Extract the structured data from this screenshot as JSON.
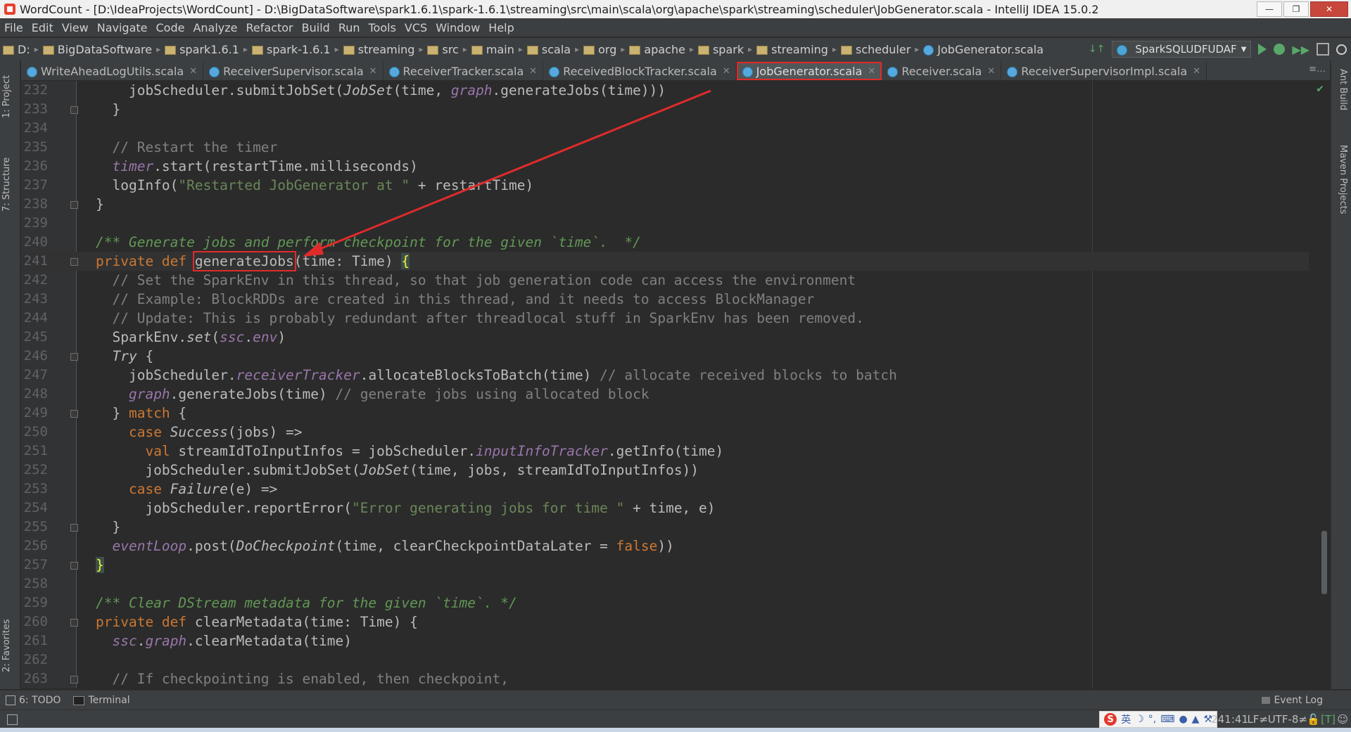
{
  "window": {
    "title": "WordCount - [D:\\IdeaProjects\\WordCount] - D:\\BigDataSoftware\\spark1.6.1\\spark-1.6.1\\streaming\\src\\main\\scala\\org\\apache\\spark\\streaming\\scheduler\\JobGenerator.scala - IntelliJ IDEA 15.0.2",
    "minimize": "—",
    "maximize": "❐",
    "close": "✕"
  },
  "menu": [
    "File",
    "Edit",
    "View",
    "Navigate",
    "Code",
    "Analyze",
    "Refactor",
    "Build",
    "Run",
    "Tools",
    "VCS",
    "Window",
    "Help"
  ],
  "breadcrumb": [
    "D:",
    "BigDataSoftware",
    "spark1.6.1",
    "spark-1.6.1",
    "streaming",
    "src",
    "main",
    "scala",
    "org",
    "apache",
    "spark",
    "streaming",
    "scheduler",
    "JobGenerator.scala"
  ],
  "run_config": "SparkSQLUDFUDAF",
  "tabs": [
    {
      "label": "WriteAheadLogUtils.scala",
      "active": false
    },
    {
      "label": "ReceiverSupervisor.scala",
      "active": false
    },
    {
      "label": "ReceiverTracker.scala",
      "active": false
    },
    {
      "label": "ReceivedBlockTracker.scala",
      "active": false
    },
    {
      "label": "JobGenerator.scala",
      "active": true
    },
    {
      "label": "Receiver.scala",
      "active": false
    },
    {
      "label": "ReceiverSupervisorImpl.scala",
      "active": false
    }
  ],
  "tab_menu": "≡…",
  "side_tools": {
    "left": [
      "1: Project",
      "7: Structure",
      "2: Favorites"
    ],
    "right": [
      "Ant Build",
      "Maven Projects"
    ]
  },
  "code_lines": [
    {
      "n": "232",
      "fold": false,
      "html": "    jobScheduler.submitJobSet(<span class=\"it\">JobSet</span>(time, <span class=\"f\">graph</span>.generateJobs(time)))"
    },
    {
      "n": "233",
      "fold": true,
      "html": "  }"
    },
    {
      "n": "234",
      "fold": false,
      "html": ""
    },
    {
      "n": "235",
      "fold": false,
      "html": "  <span class=\"c\">// Restart the timer</span>"
    },
    {
      "n": "236",
      "fold": false,
      "html": "  <span class=\"f\">timer</span>.start(restartTime.milliseconds)"
    },
    {
      "n": "237",
      "fold": false,
      "html": "  logInfo(<span class=\"s\">\"Restarted JobGenerator at \"</span> + restartTime)"
    },
    {
      "n": "238",
      "fold": true,
      "html": "}"
    },
    {
      "n": "239",
      "fold": false,
      "html": ""
    },
    {
      "n": "240",
      "fold": false,
      "html": "<span class=\"cd\">/** Generate jobs and perform checkpoint for the given `time`.  */</span>"
    },
    {
      "n": "241",
      "fold": true,
      "current": true,
      "html": "<span class=\"k\">private def </span><span class=\"hl\">generateJobs</span>(time: Time) <span class=\"brace-hl\">{</span>"
    },
    {
      "n": "242",
      "fold": false,
      "html": "  <span class=\"c\">// Set the SparkEnv in this thread, so that job generation code can access the environment</span>"
    },
    {
      "n": "243",
      "fold": false,
      "html": "  <span class=\"c\">// Example: BlockRDDs are created in this thread, and it needs to access BlockManager</span>"
    },
    {
      "n": "244",
      "fold": false,
      "html": "  <span class=\"c\">// Update: This is probably redundant after threadlocal stuff in SparkEnv has been removed.</span>"
    },
    {
      "n": "245",
      "fold": false,
      "html": "  SparkEnv.<span class=\"it\">set</span>(<span class=\"f\">ssc</span>.<span class=\"f\">env</span>)"
    },
    {
      "n": "246",
      "fold": true,
      "html": "  <span class=\"it\">Try</span> {"
    },
    {
      "n": "247",
      "fold": false,
      "html": "    jobScheduler.<span class=\"f\">receiverTracker</span>.allocateBlocksToBatch(time) <span class=\"c\">// allocate received blocks to batch</span>"
    },
    {
      "n": "248",
      "fold": false,
      "html": "    <span class=\"f\">graph</span>.generateJobs(time) <span class=\"c\">// generate jobs using allocated block</span>"
    },
    {
      "n": "249",
      "fold": true,
      "html": "  } <span class=\"k\">match</span> {"
    },
    {
      "n": "250",
      "fold": false,
      "html": "    <span class=\"k\">case </span><span class=\"it\">Success</span>(jobs) =>"
    },
    {
      "n": "251",
      "fold": false,
      "html": "      <span class=\"k\">val </span>streamIdToInputInfos = jobScheduler.<span class=\"f\">inputInfoTracker</span>.getInfo(time)"
    },
    {
      "n": "252",
      "fold": false,
      "html": "      jobScheduler.submitJobSet(<span class=\"it\">JobSet</span>(time, jobs, streamIdToInputInfos))"
    },
    {
      "n": "253",
      "fold": false,
      "html": "    <span class=\"k\">case </span><span class=\"it\">Failure</span>(e) =>"
    },
    {
      "n": "254",
      "fold": false,
      "html": "      jobScheduler.reportError(<span class=\"s\">\"Error generating jobs for time \"</span> + time, e)"
    },
    {
      "n": "255",
      "fold": true,
      "html": "  }"
    },
    {
      "n": "256",
      "fold": false,
      "html": "  <span class=\"f\">eventLoop</span>.post(<span class=\"it\">DoCheckpoint</span>(time, clearCheckpointDataLater = <span class=\"k\">false</span>))"
    },
    {
      "n": "257",
      "fold": true,
      "html": "<span class=\"brace-hl\">}</span>"
    },
    {
      "n": "258",
      "fold": false,
      "html": ""
    },
    {
      "n": "259",
      "fold": false,
      "html": "<span class=\"cd\">/** Clear DStream metadata for the given `time`. */</span>"
    },
    {
      "n": "260",
      "fold": true,
      "html": "<span class=\"k\">private def </span>clearMetadata(time: Time) {"
    },
    {
      "n": "261",
      "fold": false,
      "html": "  <span class=\"f\">ssc</span>.<span class=\"f\">graph</span>.clearMetadata(time)"
    },
    {
      "n": "262",
      "fold": false,
      "html": ""
    },
    {
      "n": "263",
      "fold": true,
      "html": "  <span class=\"c\">// If checkpointing is enabled, then checkpoint,</span>"
    }
  ],
  "bottom_tools": {
    "todo": "6: TODO",
    "terminal": "Terminal",
    "event_log": "Event Log"
  },
  "status": {
    "position": "241:41",
    "line_sep": "LF≠",
    "encoding": "UTF-8≠",
    "ime_lang": "英"
  },
  "colors": {
    "highlight_box": "#e02b2b",
    "keyword": "#cc7832",
    "string": "#6a8759",
    "comment": "#808080",
    "doc_comment": "#629755",
    "field": "#9876aa"
  }
}
